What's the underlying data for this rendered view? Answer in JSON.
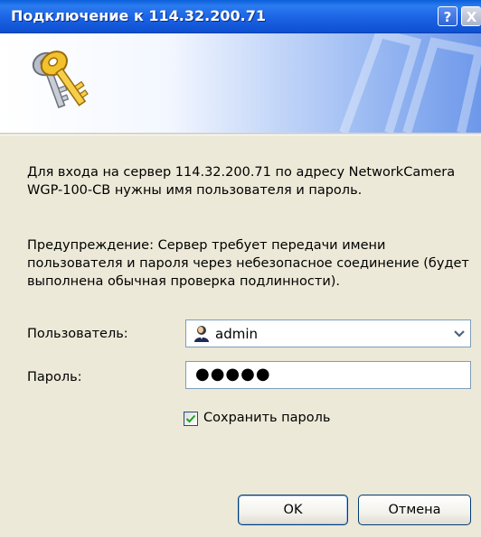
{
  "window": {
    "title": "Подключение к 114.32.200.71",
    "help_button": "?",
    "close_button": "X"
  },
  "message": {
    "line1": "Для входа на сервер 114.32.200.71 по адресу NetworkCamera WGP-100-CB нужны имя пользователя и пароль.",
    "warning": "Предупреждение: Сервер требует передачи имени пользователя и пароля через небезопасное соединение (будет выполнена обычная проверка подлинности)."
  },
  "form": {
    "user_label": "Пользователь:",
    "user_value": "admin",
    "password_label": "Пароль:",
    "password_mask": "●●●●●",
    "remember_label": "Сохранить пароль",
    "remember_checked": true
  },
  "buttons": {
    "ok": "OK",
    "cancel": "Отмена"
  },
  "colors": {
    "titlebar": "#1b63e4",
    "dialog_bg": "#ece9d8",
    "field_border": "#7f9db9"
  },
  "icons": {
    "banner": "keys-icon",
    "user": "user-icon",
    "dropdown": "chevron-down-icon",
    "checkbox": "checkmark-icon"
  }
}
